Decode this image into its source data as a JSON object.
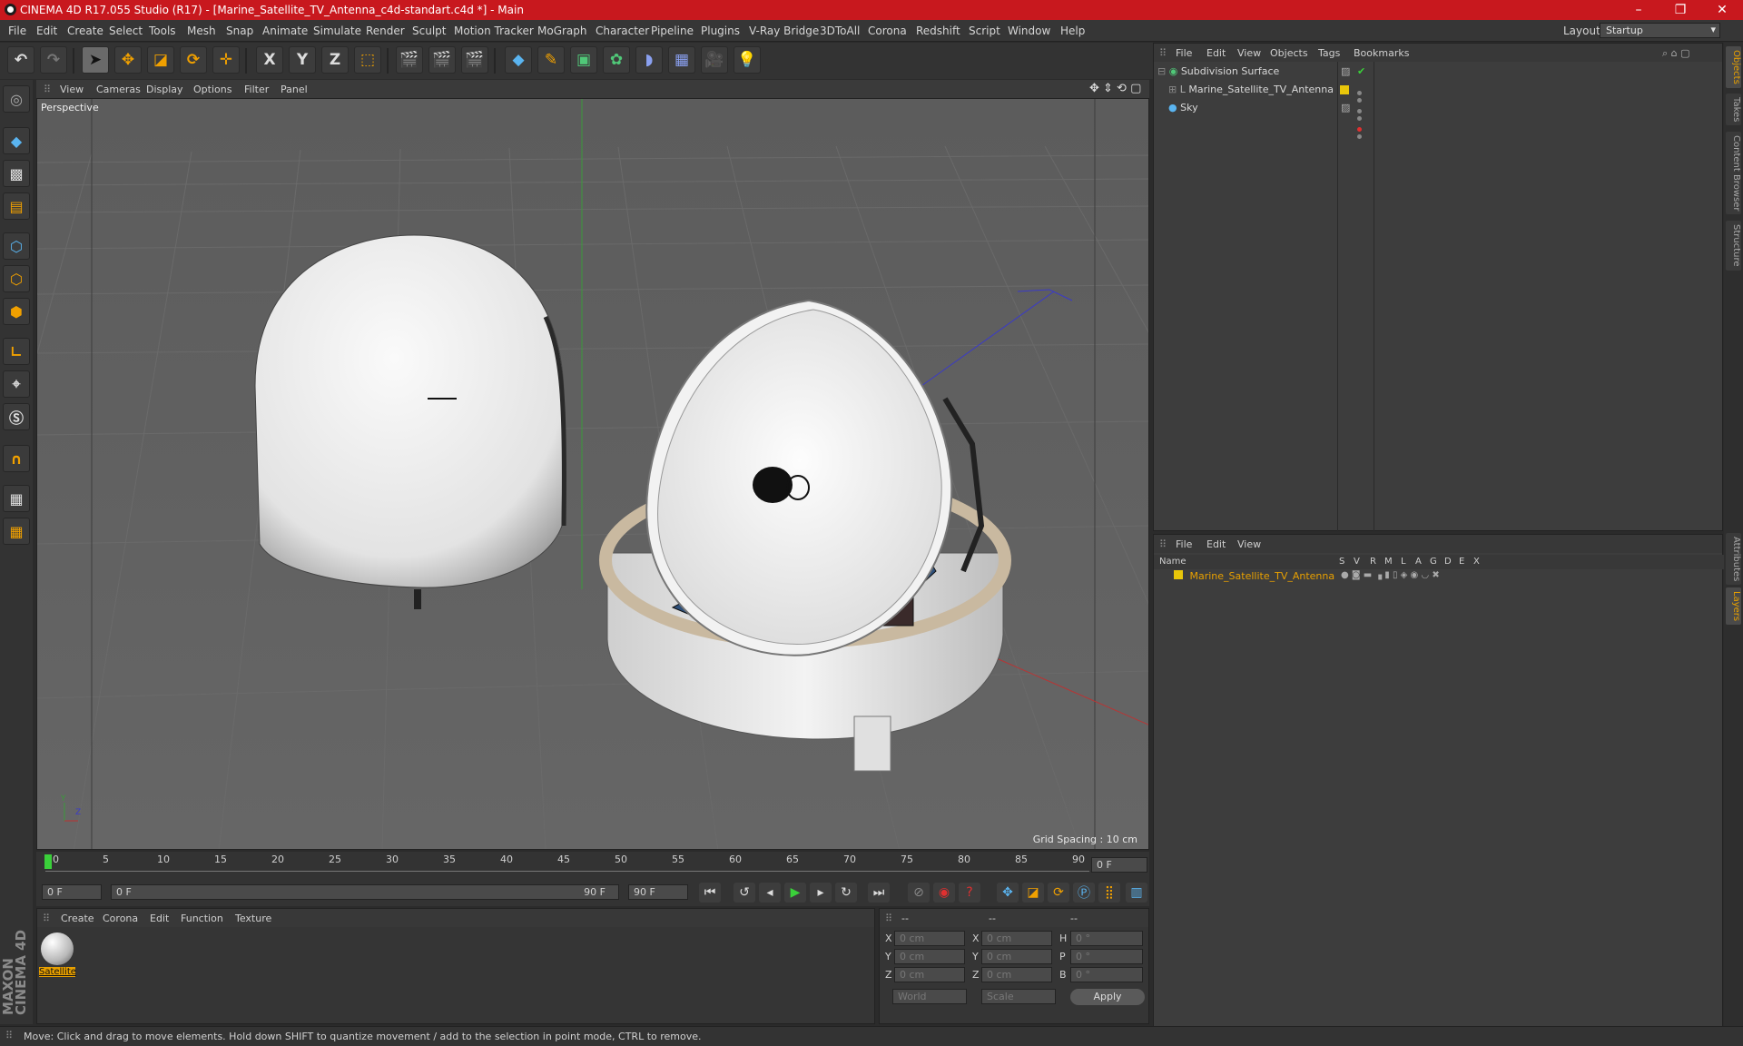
{
  "window": {
    "title": "CINEMA 4D R17.055 Studio (R17) - [Marine_Satellite_TV_Antenna_c4d-standart.c4d *] - Main",
    "minimize": "–",
    "maximize": "❐",
    "close": "✕"
  },
  "menubar": {
    "items": [
      "File",
      "Edit",
      "Create",
      "Select",
      "Tools",
      "Mesh",
      "Snap",
      "Animate",
      "Simulate",
      "Render",
      "Sculpt",
      "Motion Tracker",
      "MoGraph",
      "Character",
      "Pipeline",
      "Plugins",
      "V-Ray Bridge",
      "3DToAll",
      "Corona",
      "Redshift",
      "Script",
      "Window",
      "Help"
    ],
    "layout_label": "Layout:",
    "layout_value": "Startup"
  },
  "toolbar": {
    "axis_x": "X",
    "axis_y": "Y",
    "axis_z": "Z"
  },
  "viewport": {
    "menu": [
      "View",
      "Cameras",
      "Display",
      "Options",
      "Filter",
      "Panel"
    ],
    "label": "Perspective",
    "grid_spacing": "Grid Spacing : 10 cm"
  },
  "timeline": {
    "ticks": [
      "0",
      "5",
      "10",
      "15",
      "20",
      "25",
      "30",
      "35",
      "40",
      "45",
      "50",
      "55",
      "60",
      "65",
      "70",
      "75",
      "80",
      "85",
      "90"
    ],
    "current_frame": "0 F"
  },
  "transport": {
    "start": "0 F",
    "range_start": "0 F",
    "range_end": "90 F",
    "end": "90 F"
  },
  "materials": {
    "menu": [
      "Create",
      "Corona",
      "Edit",
      "Function",
      "Texture"
    ],
    "items": [
      {
        "name": "Satellite"
      }
    ]
  },
  "coords": {
    "header": [
      "--",
      "--",
      "--"
    ],
    "rows": [
      {
        "a": "X",
        "av": "0 cm",
        "b": "X",
        "bv": "0 cm",
        "c": "H",
        "cv": "0 °"
      },
      {
        "a": "Y",
        "av": "0 cm",
        "b": "Y",
        "bv": "0 cm",
        "c": "P",
        "cv": "0 °"
      },
      {
        "a": "Z",
        "av": "0 cm",
        "b": "Z",
        "bv": "0 cm",
        "c": "B",
        "cv": "0 °"
      }
    ],
    "mode1": "World",
    "mode2": "Scale",
    "apply": "Apply"
  },
  "object_manager": {
    "menu": [
      "File",
      "Edit",
      "View",
      "Objects",
      "Tags",
      "Bookmarks"
    ],
    "objects": [
      {
        "name": "Subdivision Surface"
      },
      {
        "name": "Marine_Satellite_TV_Antenna"
      },
      {
        "name": "Sky"
      }
    ]
  },
  "layer_manager": {
    "menu": [
      "File",
      "Edit",
      "View"
    ],
    "columns": [
      "Name",
      "S",
      "V",
      "R",
      "M",
      "L",
      "A",
      "G",
      "D",
      "E",
      "X"
    ],
    "layers": [
      {
        "name": "Marine_Satellite_TV_Antenna",
        "color": "#e8c60a"
      }
    ]
  },
  "right_tabs": [
    "Objects",
    "Takes",
    "Content Browser",
    "Structure",
    "Attributes",
    "Layers"
  ],
  "brand": "MAXON CINEMA 4D",
  "status": "Move: Click and drag to move elements. Hold down SHIFT to quantize movement / add to the selection in point mode, CTRL to remove.",
  "colors": {
    "titlebar": "#c8181e",
    "accent": "#e8a000",
    "layer_yellow": "#e8c60a"
  }
}
